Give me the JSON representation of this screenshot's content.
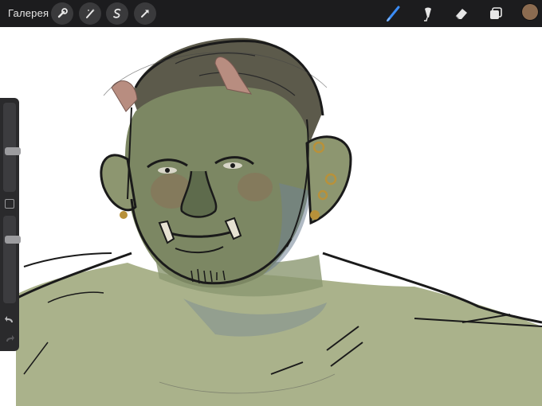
{
  "toolbar": {
    "gallery_label": "Галерея",
    "left_tools": [
      "wrench-icon",
      "magic-wand-icon",
      "selection-icon",
      "transform-icon"
    ],
    "right_tools": [
      "brush-icon",
      "smudge-icon",
      "eraser-icon",
      "layers-icon"
    ],
    "active_tool": "brush",
    "current_color": "#8b6b50"
  },
  "sidebar": {
    "brush_size_level": 0.45,
    "opacity_level": 0.75,
    "icons": [
      "undo-icon",
      "redo-icon"
    ]
  },
  "canvas": {
    "content": "orc-portrait-sketch",
    "colors": {
      "skin": "#aab28b",
      "face": "#7c8763",
      "line": "#1a1a1a",
      "shadow": "#6f8294",
      "hair": "#5c5a4b",
      "horn": "#b88d80",
      "earring": "#b8913a"
    }
  }
}
